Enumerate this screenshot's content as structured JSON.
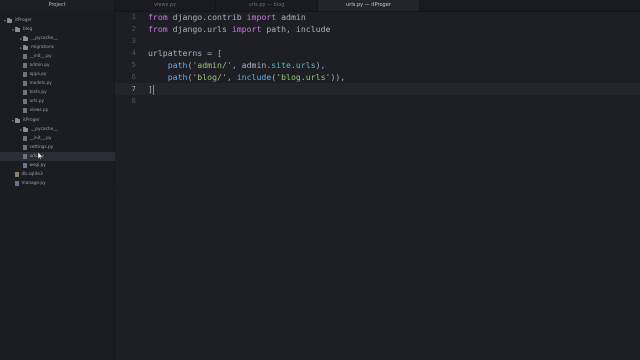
{
  "tabs": [
    {
      "label": "Project"
    },
    {
      "label": "views.py"
    },
    {
      "label": "urls.py — blog"
    },
    {
      "label": "urls.py — itProger"
    }
  ],
  "tree": [
    {
      "label": "itProger",
      "kind": "folder",
      "depth": 0,
      "expanded": true
    },
    {
      "label": "blog",
      "kind": "folder",
      "depth": 1,
      "expanded": true
    },
    {
      "label": "migrations",
      "kind": "folder",
      "depth": 2,
      "expanded": false
    },
    {
      "label": "__pycache__",
      "kind": "folder",
      "depth": 2,
      "expanded": false
    },
    {
      "label": "__init__.py",
      "kind": "file",
      "depth": 2
    },
    {
      "label": "admin.py",
      "kind": "file",
      "depth": 2
    },
    {
      "label": "apps.py",
      "kind": "file",
      "depth": 2
    },
    {
      "label": "models.py",
      "kind": "file",
      "depth": 2
    },
    {
      "label": "tests.py",
      "kind": "file",
      "depth": 2
    },
    {
      "label": "urls.py",
      "kind": "file",
      "depth": 2
    },
    {
      "label": "views.py",
      "kind": "file",
      "depth": 2
    },
    {
      "label": "itProger",
      "kind": "folder",
      "depth": 1,
      "expanded": true
    },
    {
      "label": "__pycache__",
      "kind": "folder",
      "depth": 2,
      "expanded": false
    },
    {
      "label": "__init__.py",
      "kind": "file",
      "depth": 2
    },
    {
      "label": "settings.py",
      "kind": "file",
      "depth": 2
    },
    {
      "label": "urls.py",
      "kind": "file",
      "depth": 2,
      "selected": true
    },
    {
      "label": "wsgi.py",
      "kind": "file",
      "depth": 2
    },
    {
      "label": "db.sqlite3",
      "kind": "db",
      "depth": 1
    },
    {
      "label": "manage.py",
      "kind": "file",
      "depth": 1
    }
  ],
  "editor": {
    "line_numbers": [
      "1",
      "2",
      "3",
      "4",
      "5",
      "6",
      "7",
      "8"
    ],
    "active_line": "7",
    "lines": [
      [
        {
          "t": "from ",
          "c": "kw"
        },
        {
          "t": "django",
          "c": "mod"
        },
        {
          "t": ".",
          "c": "punct"
        },
        {
          "t": "contrib",
          "c": "mod"
        },
        {
          "t": " import ",
          "c": "kw"
        },
        {
          "t": "admin",
          "c": "id"
        }
      ],
      [
        {
          "t": "from ",
          "c": "kw"
        },
        {
          "t": "django",
          "c": "mod"
        },
        {
          "t": ".",
          "c": "punct"
        },
        {
          "t": "urls",
          "c": "mod"
        },
        {
          "t": " import ",
          "c": "kw"
        },
        {
          "t": "path, include",
          "c": "id"
        }
      ],
      [],
      [
        {
          "t": "urlpatterns = [",
          "c": "id"
        }
      ],
      [
        {
          "t": "    ",
          "c": "id"
        },
        {
          "t": "path",
          "c": "fn"
        },
        {
          "t": "(",
          "c": "punct"
        },
        {
          "t": "'admin/'",
          "c": "str"
        },
        {
          "t": ", admin.",
          "c": "id"
        },
        {
          "t": "site",
          "c": "attr"
        },
        {
          "t": ".",
          "c": "punct"
        },
        {
          "t": "urls",
          "c": "attr"
        },
        {
          "t": "),",
          "c": "punct"
        }
      ],
      [
        {
          "t": "    ",
          "c": "id"
        },
        {
          "t": "path",
          "c": "fn"
        },
        {
          "t": "(",
          "c": "punct"
        },
        {
          "t": "'blog/'",
          "c": "str"
        },
        {
          "t": ", ",
          "c": "punct"
        },
        {
          "t": "include",
          "c": "fn"
        },
        {
          "t": "(",
          "c": "punct"
        },
        {
          "t": "'blog.urls'",
          "c": "str"
        },
        {
          "t": ")),",
          "c": "punct"
        }
      ],
      [
        {
          "t": "]",
          "c": "punct"
        }
      ],
      []
    ]
  },
  "colors": {
    "keyword": "#c678dd",
    "function": "#61afef",
    "string": "#98c379",
    "attribute": "#56b6c2",
    "caret": "#528bff"
  }
}
